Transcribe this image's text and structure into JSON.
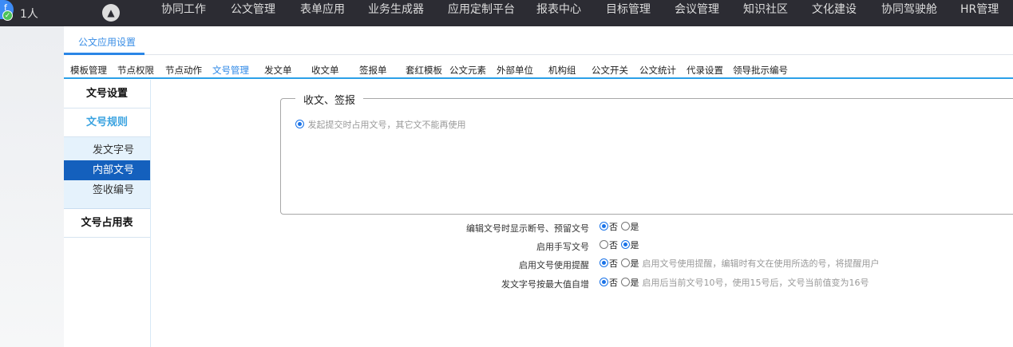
{
  "topbar": {
    "avatar_letter": "f",
    "online_count": "1人",
    "nav": [
      "协同工作",
      "公文管理",
      "表单应用",
      "业务生成器",
      "应用定制平台",
      "报表中心",
      "目标管理",
      "会议管理",
      "知识社区",
      "文化建设",
      "协同驾驶舱",
      "HR管理"
    ]
  },
  "tabs": {
    "active": "公文应用设置"
  },
  "subtabs": [
    "模板管理",
    "节点权限",
    "节点动作",
    "文号管理",
    "发文单",
    "收文单",
    "签报单",
    "套红模板",
    "公文元素",
    "外部单位",
    "机构组",
    "公文开关",
    "公文统计",
    "代录设置",
    "领导批示编号"
  ],
  "subtabs_active": "文号管理",
  "sidebar": {
    "header1": "文号设置",
    "header2": "文号规则",
    "items": [
      "发文字号",
      "内部文号",
      "签收编号"
    ],
    "selected": "内部文号",
    "header3": "文号占用表"
  },
  "fieldset": {
    "legend": "收文、签报",
    "option": "发起提交时占用文号，其它文不能再使用"
  },
  "rows": [
    {
      "label": "编辑文号时显示断号、预留文号",
      "no": "否",
      "yes": "是",
      "value": "否",
      "hint": ""
    },
    {
      "label": "启用手写文号",
      "no": "否",
      "yes": "是",
      "value": "是",
      "hint": ""
    },
    {
      "label": "启用文号使用提醒",
      "no": "否",
      "yes": "是",
      "value": "否",
      "hint": "启用文号使用提醒，编辑时有文在使用所选的号，将提醒用户"
    },
    {
      "label": "发文字号按最大值自增",
      "no": "否",
      "yes": "是",
      "value": "否",
      "hint": "启用后当前文号10号，使用15号后，文号当前值变为16号"
    }
  ],
  "colors": {
    "topbar": "#2c2c33",
    "accent": "#2a86e6",
    "sidebar_selected": "#1460bd"
  }
}
